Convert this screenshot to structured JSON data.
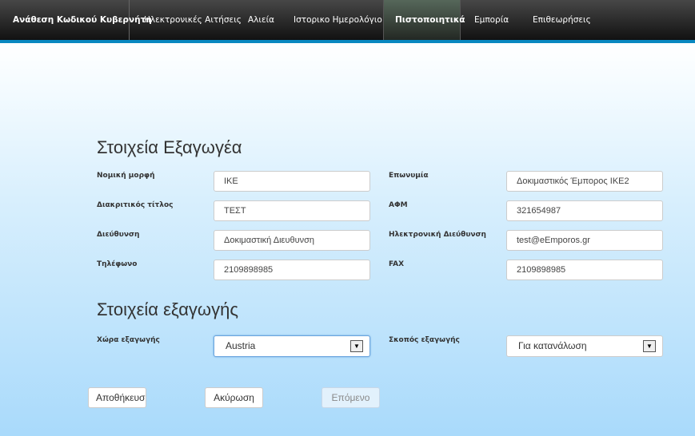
{
  "nav": {
    "items": [
      {
        "label": "Ανάθεση Κωδικού Κυβερνήτη"
      },
      {
        "label": "Ηλεκτρονικές Αιτήσεις"
      },
      {
        "label": "Αλιεία"
      },
      {
        "label": "Ιστορικο Ημερολόγιο"
      },
      {
        "label": "Πιστοποιητικά",
        "active": true
      },
      {
        "label": "Εμπορία"
      },
      {
        "label": "Επιθεωρήσεις"
      }
    ]
  },
  "exporter": {
    "title": "Στοιχεία Εξαγωγέα",
    "fields": [
      {
        "label": "Νομική μορφή",
        "value": "ΙΚΕ"
      },
      {
        "label": "Επωνυμία",
        "value": "Δοκιμαστικός Έμπορος ΙΚΕ2"
      },
      {
        "label": "Διακριτικός τίτλος",
        "value": "ΤΕΣΤ"
      },
      {
        "label": "ΑΦΜ",
        "value": "321654987"
      },
      {
        "label": "Διεύθυνση",
        "value": "Δοκιμαστική Διευθυνση"
      },
      {
        "label": "Ηλεκτρονική Διεύθυνση",
        "value": "test@eEmporos.gr"
      },
      {
        "label": "Τηλέφωνο",
        "value": "2109898985"
      },
      {
        "label": "FAX",
        "value": "2109898985"
      }
    ]
  },
  "export": {
    "title": "Στοιχεία εξαγωγής",
    "country": {
      "label": "Χώρα εξαγωγής",
      "value": "Austria"
    },
    "purpose": {
      "label": "Σκοπός εξαγωγής",
      "value": "Για κατανάλωση"
    }
  },
  "buttons": {
    "save": "Αποθήκευση",
    "cancel": "Ακύρωση",
    "next": "Επόμενο"
  }
}
